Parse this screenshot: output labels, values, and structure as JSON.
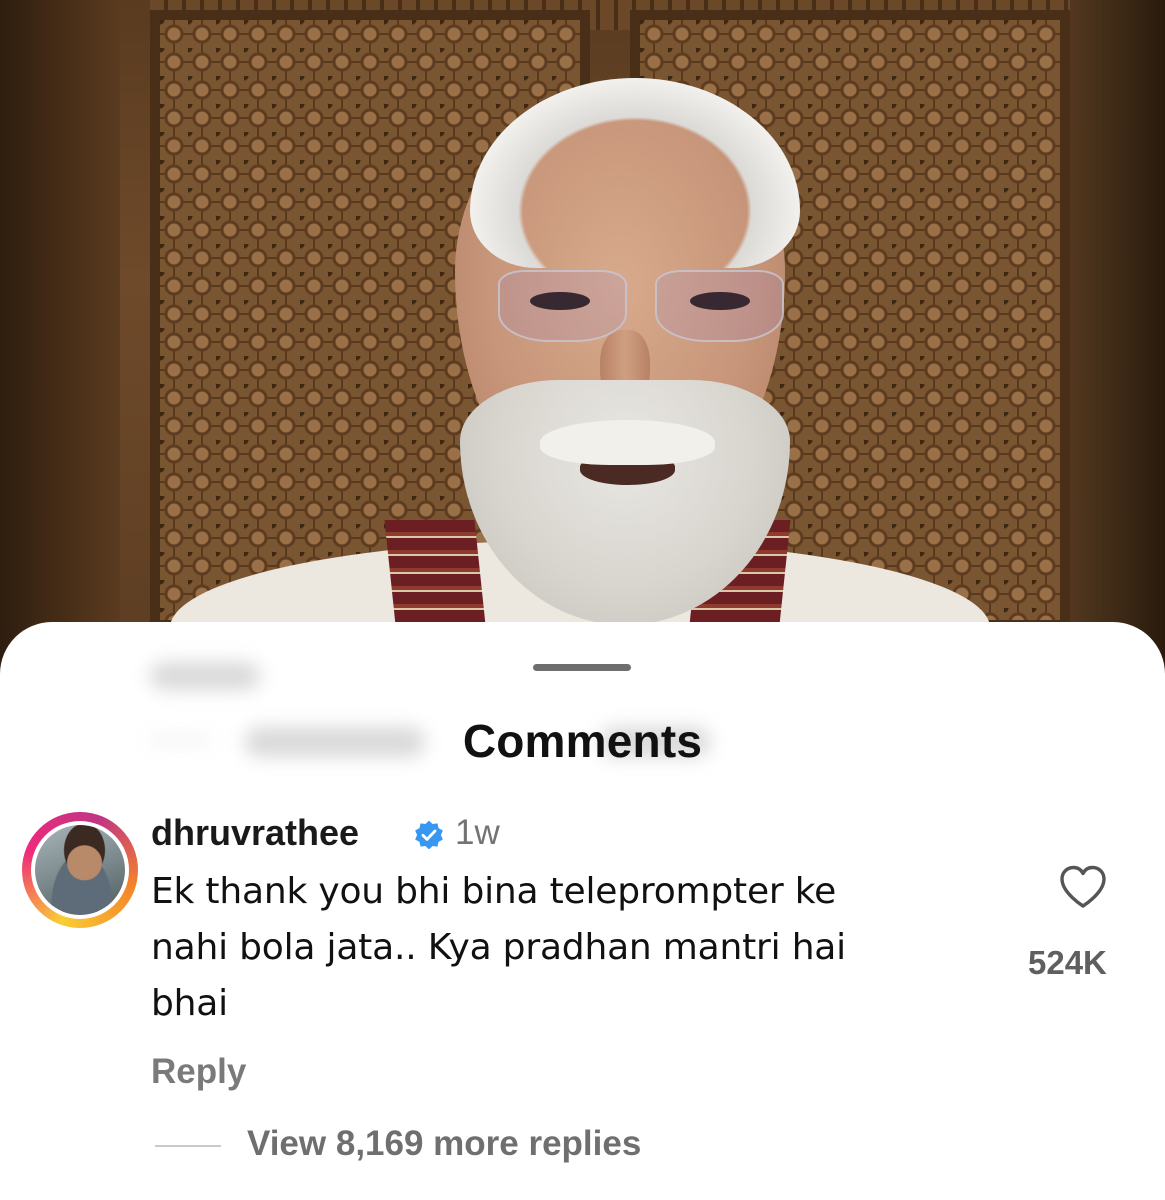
{
  "video": {
    "background_colors": {
      "wood": "#6e4a2a",
      "frame": "#4a2f18",
      "attire": "#ece8e0"
    }
  },
  "sheet": {
    "title": "Comments",
    "background": "#ffffff"
  },
  "comment": {
    "username": "dhruvrathee",
    "verified": true,
    "verified_icon": "verified-badge-icon",
    "time_ago": "1w",
    "text_lines": [
      "Ek thank you bhi bina teleprompter ke",
      "nahi bola jata.. Kya pradhan mantri hai",
      "bhai"
    ],
    "like_icon": "heart-outline-icon",
    "like_count": "524K",
    "reply_label": "Reply",
    "view_replies_label": "View 8,169 more replies"
  },
  "colors": {
    "badge_blue": "#3897f0",
    "muted_text": "#737373",
    "primary_text": "#111111"
  }
}
